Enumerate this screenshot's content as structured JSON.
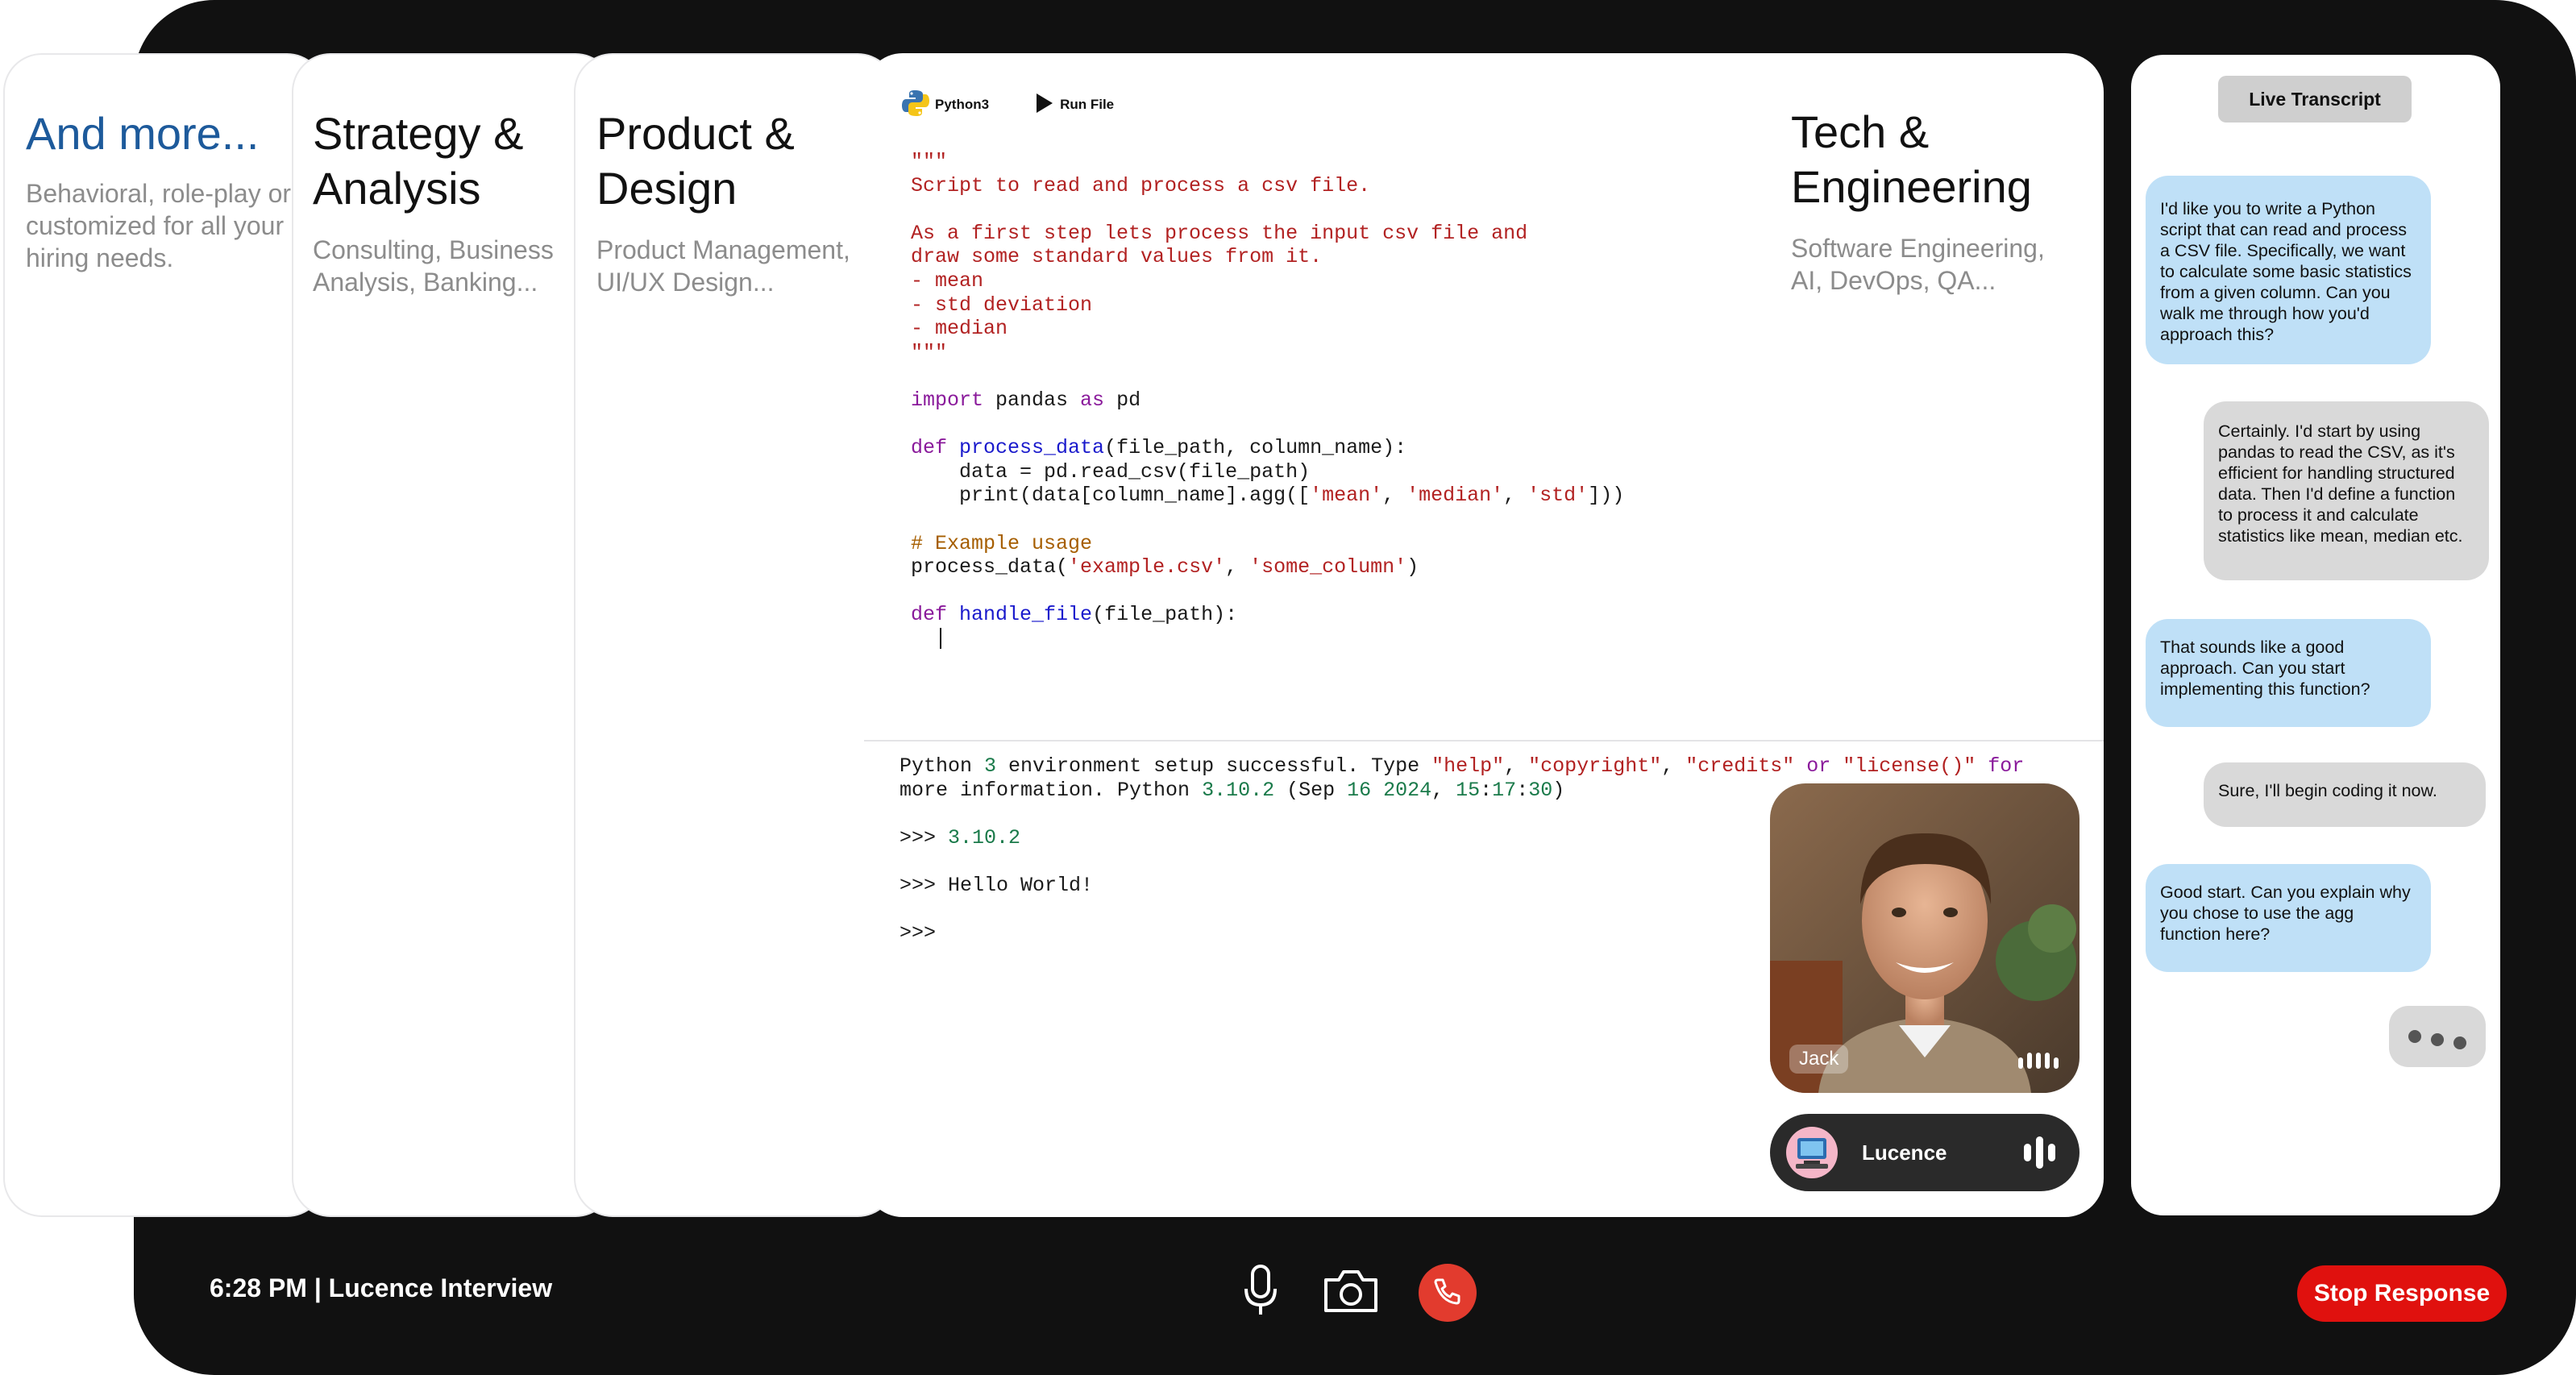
{
  "cards": {
    "more": {
      "title": "And more...",
      "subtitle": "Behavioral, role-play or customized for all your hiring needs."
    },
    "strategy": {
      "title": "Strategy & Analysis",
      "subtitle": "Consulting, Business Analysis, Banking..."
    },
    "product": {
      "title": "Product & Design",
      "subtitle": "Product Management, UI/UX Design..."
    },
    "tech": {
      "title": "Tech & Engineering",
      "subtitle": "Software Engineering, AI, DevOps, QA..."
    }
  },
  "editor": {
    "language_label": "Python3",
    "run_label": "Run File"
  },
  "console": {
    "l1a": "Python ",
    "l1b": "3",
    "l1c": " environment setup successful. Type ",
    "l1d": "\"help\"",
    "l1e": ", ",
    "l1f": "\"copyright\"",
    "l1g": ", ",
    "l1h": "\"credits\"",
    "l1i": " or ",
    "l1j": "\"license()\"",
    "l1k": " for",
    "l1l": " more information. Python ",
    "l1m": "3.10.2",
    "l1n": " (Sep ",
    "l1o": "16 2024",
    "l1p": ", ",
    "l1q": "15",
    "l1r": ":",
    "l1s": "17",
    "l1t": ":",
    "l1u": "30",
    "l1v": ")",
    "prompt": ">>> ",
    "out1": "3.10.2",
    "out2": "Hello World!"
  },
  "video": {
    "name": "Jack"
  },
  "interviewer": {
    "name": "Lucence"
  },
  "transcript": {
    "button": "Live Transcript",
    "m1": "I'd like you to write a Python script that can read and process a CSV file. Specifically, we want to calculate some basic statistics from a given column. Can you walk me through how you'd approach this?",
    "m2": "Certainly. I'd start by using pandas to read the CSV, as it's efficient for handling structured data. Then I'd define a function to process it and calculate statistics like mean, median etc.",
    "m3": "That sounds like a good approach. Can you start implementing this function?",
    "m4": "Sure, I'll begin coding it now.",
    "m5": "Good start. Can you explain why you chose to use the agg function here?"
  },
  "footer": {
    "status": "6:28 PM | Lucence Interview",
    "stop": "Stop Response"
  },
  "colors": {
    "accent_blue": "#1d5a9b",
    "stop_red": "#e0110e",
    "end_call": "#e23b2e",
    "bubble_blue": "#bfe0f7",
    "bubble_gray": "#d9d9d9"
  },
  "icons": [
    "python-logo-icon",
    "play-icon",
    "microphone-icon",
    "camera-icon",
    "phone-end-icon",
    "audio-bars-icon",
    "typing-dots-icon"
  ]
}
